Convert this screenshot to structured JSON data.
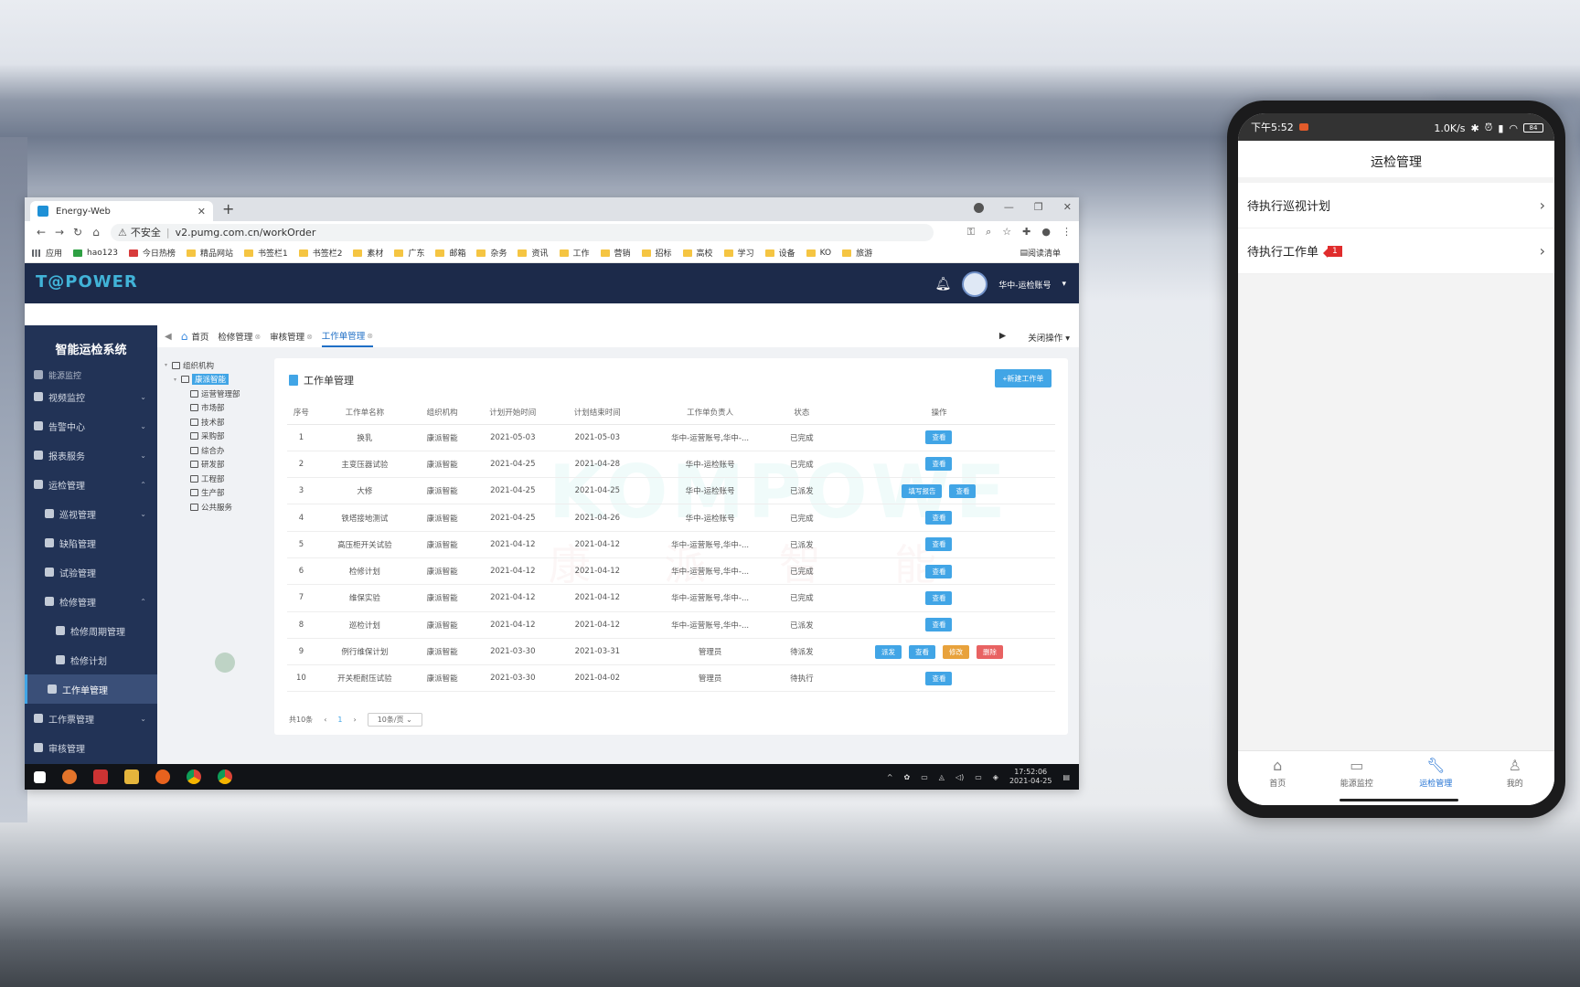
{
  "browser": {
    "tab_title": "Energy-Web",
    "tab_close": "✕",
    "new_tab": "+",
    "url_warning": "不安全",
    "url": "v2.pumg.com.cn/workOrder",
    "bookmarks": [
      "应用",
      "hao123",
      "今日热榜",
      "精品网站",
      "书签栏1",
      "书签栏2",
      "素材",
      "广东",
      "邮箱",
      "杂务",
      "资讯",
      "工作",
      "营销",
      "招标",
      "高校",
      "学习",
      "设备",
      "KO",
      "旅游"
    ],
    "reading_list": "阅读清单"
  },
  "app": {
    "logo": "T@POWER",
    "account": "华中-运检账号",
    "system_title": "智能运检系统",
    "sidebar": [
      {
        "label": "能源监控",
        "level": 0,
        "partial": true
      },
      {
        "label": "视频监控",
        "level": 0,
        "arrow": "⌄"
      },
      {
        "label": "告警中心",
        "level": 0,
        "arrow": "⌄"
      },
      {
        "label": "报表服务",
        "level": 0,
        "arrow": "⌄"
      },
      {
        "label": "运检管理",
        "level": 0,
        "arrow": "⌃"
      },
      {
        "label": "巡视管理",
        "level": 1,
        "arrow": "⌄"
      },
      {
        "label": "缺陷管理",
        "level": 1
      },
      {
        "label": "试验管理",
        "level": 1
      },
      {
        "label": "检修管理",
        "level": 1,
        "arrow": "⌃"
      },
      {
        "label": "检修周期管理",
        "level": 2
      },
      {
        "label": "检修计划",
        "level": 2
      },
      {
        "label": "工作单管理",
        "level": 1,
        "active": true
      },
      {
        "label": "工作票管理",
        "level": 0,
        "arrow": "⌄"
      },
      {
        "label": "审核管理",
        "level": 0
      }
    ],
    "tabs": [
      "首页",
      "检修管理",
      "审核管理",
      "工作单管理"
    ],
    "close_ops": "关闭操作",
    "tree": [
      {
        "label": "组织机构",
        "level": 0
      },
      {
        "label": "康派智能",
        "level": 1,
        "selected": true
      },
      {
        "label": "运营管理部",
        "level": 2
      },
      {
        "label": "市场部",
        "level": 2
      },
      {
        "label": "技术部",
        "level": 2
      },
      {
        "label": "采购部",
        "level": 2
      },
      {
        "label": "综合办",
        "level": 2
      },
      {
        "label": "研发部",
        "level": 2
      },
      {
        "label": "工程部",
        "level": 2
      },
      {
        "label": "生产部",
        "level": 2
      },
      {
        "label": "公共服务",
        "level": 2
      }
    ],
    "panel_title": "工作单管理",
    "new_button": "+新建工作单",
    "columns": [
      "序号",
      "工作单名称",
      "组织机构",
      "计划开始时间",
      "计划结束时间",
      "工作单负责人",
      "状态",
      "操作"
    ],
    "rows": [
      {
        "no": "1",
        "name": "换乳",
        "org": "康派智能",
        "start": "2021-05-03",
        "end": "2021-05-03",
        "owner": "华中-运营账号,华中-...",
        "status": "已完成",
        "ops": [
          "查看"
        ]
      },
      {
        "no": "2",
        "name": "主变压器试验",
        "org": "康派智能",
        "start": "2021-04-25",
        "end": "2021-04-28",
        "owner": "华中-运检账号",
        "status": "已完成",
        "ops": [
          "查看"
        ]
      },
      {
        "no": "3",
        "name": "大修",
        "org": "康派智能",
        "start": "2021-04-25",
        "end": "2021-04-25",
        "owner": "华中-运检账号",
        "status": "已派发",
        "ops": [
          "填写报告",
          "查看"
        ]
      },
      {
        "no": "4",
        "name": "铁塔接地测试",
        "org": "康派智能",
        "start": "2021-04-25",
        "end": "2021-04-26",
        "owner": "华中-运检账号",
        "status": "已完成",
        "ops": [
          "查看"
        ]
      },
      {
        "no": "5",
        "name": "高压柜开关试验",
        "org": "康派智能",
        "start": "2021-04-12",
        "end": "2021-04-12",
        "owner": "华中-运营账号,华中-...",
        "status": "已派发",
        "ops": [
          "查看"
        ]
      },
      {
        "no": "6",
        "name": "检修计划",
        "org": "康派智能",
        "start": "2021-04-12",
        "end": "2021-04-12",
        "owner": "华中-运营账号,华中-...",
        "status": "已完成",
        "ops": [
          "查看"
        ]
      },
      {
        "no": "7",
        "name": "维保实验",
        "org": "康派智能",
        "start": "2021-04-12",
        "end": "2021-04-12",
        "owner": "华中-运营账号,华中-...",
        "status": "已完成",
        "ops": [
          "查看"
        ]
      },
      {
        "no": "8",
        "name": "巡检计划",
        "org": "康派智能",
        "start": "2021-04-12",
        "end": "2021-04-12",
        "owner": "华中-运营账号,华中-...",
        "status": "已派发",
        "ops": [
          "查看"
        ]
      },
      {
        "no": "9",
        "name": "例行维保计划",
        "org": "康派智能",
        "start": "2021-03-30",
        "end": "2021-03-31",
        "owner": "管理员",
        "status": "待派发",
        "ops": [
          "派发",
          "查看",
          "修改",
          "删除"
        ]
      },
      {
        "no": "10",
        "name": "开关柜耐压试验",
        "org": "康派智能",
        "start": "2021-03-30",
        "end": "2021-04-02",
        "owner": "管理员",
        "status": "待执行",
        "ops": [
          "查看"
        ]
      }
    ],
    "watermark": "KOMPOWE",
    "watermark_cn": "康派智能",
    "pagination": {
      "total": "共10条",
      "prev": "‹",
      "page": "1",
      "next": "›",
      "size": "10条/页"
    }
  },
  "taskbar": {
    "time": "17:52:06",
    "date": "2021-04-25"
  },
  "phone": {
    "time": "下午5:52",
    "net": "1.0K/s",
    "battery": "84",
    "title": "运检管理",
    "items": [
      {
        "label": "待执行巡视计划"
      },
      {
        "label": "待执行工作单",
        "badge": "1"
      }
    ],
    "nav": [
      {
        "label": "首页",
        "icon": "home-icon"
      },
      {
        "label": "能源监控",
        "icon": "chart-icon"
      },
      {
        "label": "运检管理",
        "icon": "wrench-icon",
        "active": true
      },
      {
        "label": "我的",
        "icon": "user-icon"
      }
    ]
  }
}
